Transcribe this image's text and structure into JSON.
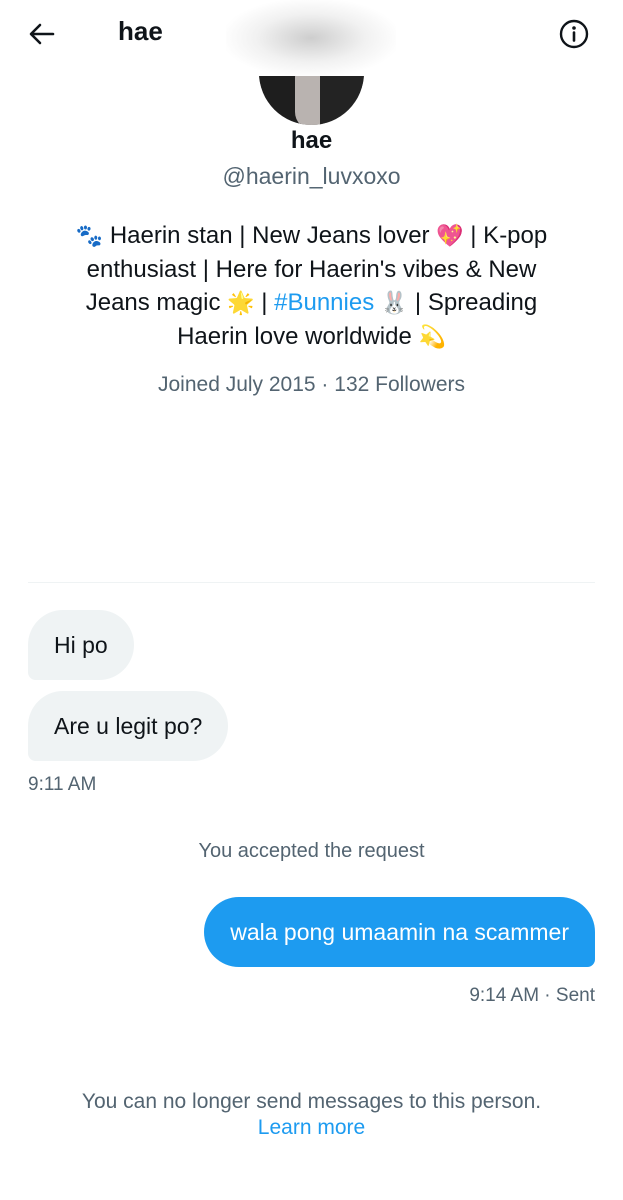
{
  "header": {
    "title": "hae",
    "back_icon": "arrow-left-icon",
    "info_icon": "info-circle-icon"
  },
  "profile": {
    "name": "hae",
    "handle": "@haerin_luvxoxo",
    "bio": {
      "paws_emoji": "🐾",
      "text1": " Haerin stan | New Jeans lover ",
      "heart_emoji": "💖",
      "text2": " | K-pop enthusiast | Here for Haerin's vibes & New Jeans magic ",
      "star_emoji": "🌟",
      "text3": " | ",
      "hashtag": "#Bunnies",
      "text4": " ",
      "bunny_emoji": "🐰",
      "text5": " | Spreading Haerin love worldwide ",
      "dizzy_emoji": "💫"
    },
    "meta": "Joined July 2015 · 132 Followers"
  },
  "messages": {
    "incoming": [
      {
        "text": "Hi po"
      },
      {
        "text": "Are u legit po?"
      }
    ],
    "incoming_time": "9:11 AM",
    "system_notice": "You accepted the request",
    "outgoing": [
      {
        "text": "wala pong umaamin na scammer"
      }
    ],
    "outgoing_time": "9:14 AM · Sent"
  },
  "footer": {
    "notice": "You can no longer send messages to this person.",
    "learn_more": "Learn more"
  },
  "colors": {
    "accent": "#1d9bf0",
    "secondary_text": "#536471",
    "bubble_incoming": "#eff3f4"
  }
}
